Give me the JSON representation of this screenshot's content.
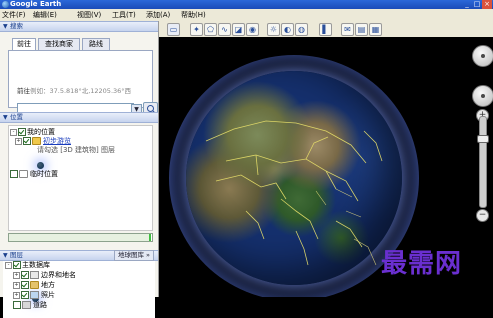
{
  "window": {
    "title": "Google Earth",
    "controls": [
      "_",
      "□",
      "×"
    ]
  },
  "menu": {
    "items": [
      "文件(F)",
      "编辑(E)",
      "视图(V)",
      "工具(T)",
      "添加(A)",
      "帮助(H)"
    ]
  },
  "search_panel": {
    "header": "搜索",
    "tabs": [
      "前往",
      "查找商家",
      "路线"
    ],
    "hint_label": "前往",
    "hint_example": "例如：37.5.818°北,12205.36°西",
    "input_value": ""
  },
  "places_panel": {
    "header": "位置",
    "items": [
      {
        "label": "我的位置",
        "checked": true,
        "expanded": true
      },
      {
        "label": "初步游览",
        "checked": true,
        "link": true
      },
      {
        "label": "请勾选 [3D 建筑物] 图层",
        "sub": true
      },
      {
        "label": "临时位置",
        "checked": false
      }
    ]
  },
  "layers_panel": {
    "header": "图层",
    "gallery_button": "地球图库 »",
    "items": [
      {
        "label": "主数据库",
        "checked": true
      },
      {
        "label": "边界和地名",
        "checked": true
      },
      {
        "label": "地方",
        "checked": true
      },
      {
        "label": "照片",
        "checked": true
      },
      {
        "label": "道路",
        "checked": false
      }
    ]
  },
  "toolbar": {
    "icons": [
      "sidebar-icon",
      "placemark-icon",
      "polygon-icon",
      "path-icon",
      "overlay-icon",
      "tour-icon",
      "sun-icon",
      "sky-icon",
      "ruler-icon",
      "email-icon",
      "print-icon",
      "maps-icon"
    ]
  },
  "globe": {
    "view": "Asia"
  },
  "watermark": "最需网",
  "colors": {
    "title_bar": "#1a4bb8",
    "menu_bg": "#ece9d8",
    "link": "#1a3dbd",
    "watermark": "#6a2fd0"
  }
}
